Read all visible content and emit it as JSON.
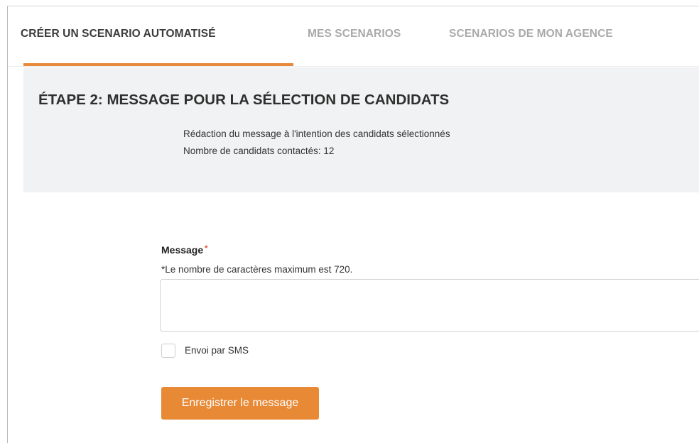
{
  "tabs": [
    {
      "label": "CRÉER UN SCENARIO AUTOMATISÉ",
      "active": true
    },
    {
      "label": "MES SCENARIOS",
      "active": false
    },
    {
      "label": "SCENARIOS DE MON AGENCE",
      "active": false
    }
  ],
  "step": {
    "title": "ÉTAPE 2: MESSAGE POUR LA SÉLECTION DE CANDIDATS",
    "description": "Rédaction du message à l'intention des candidats sélectionnés",
    "count_text": "Nombre de candidats contactés: 12"
  },
  "form": {
    "message_label": "Message",
    "required_marker": "*",
    "max_chars_hint": "*Le nombre de caractères maximum est 720.",
    "message_value": "",
    "sms_label": "Envoi par SMS",
    "sms_checked": false,
    "save_label": "Enregistrer le message"
  },
  "colors": {
    "accent": "#e88935",
    "panel_bg": "#f1f2f3",
    "inactive_tab": "#a9a9a9",
    "required": "#e0493b"
  }
}
